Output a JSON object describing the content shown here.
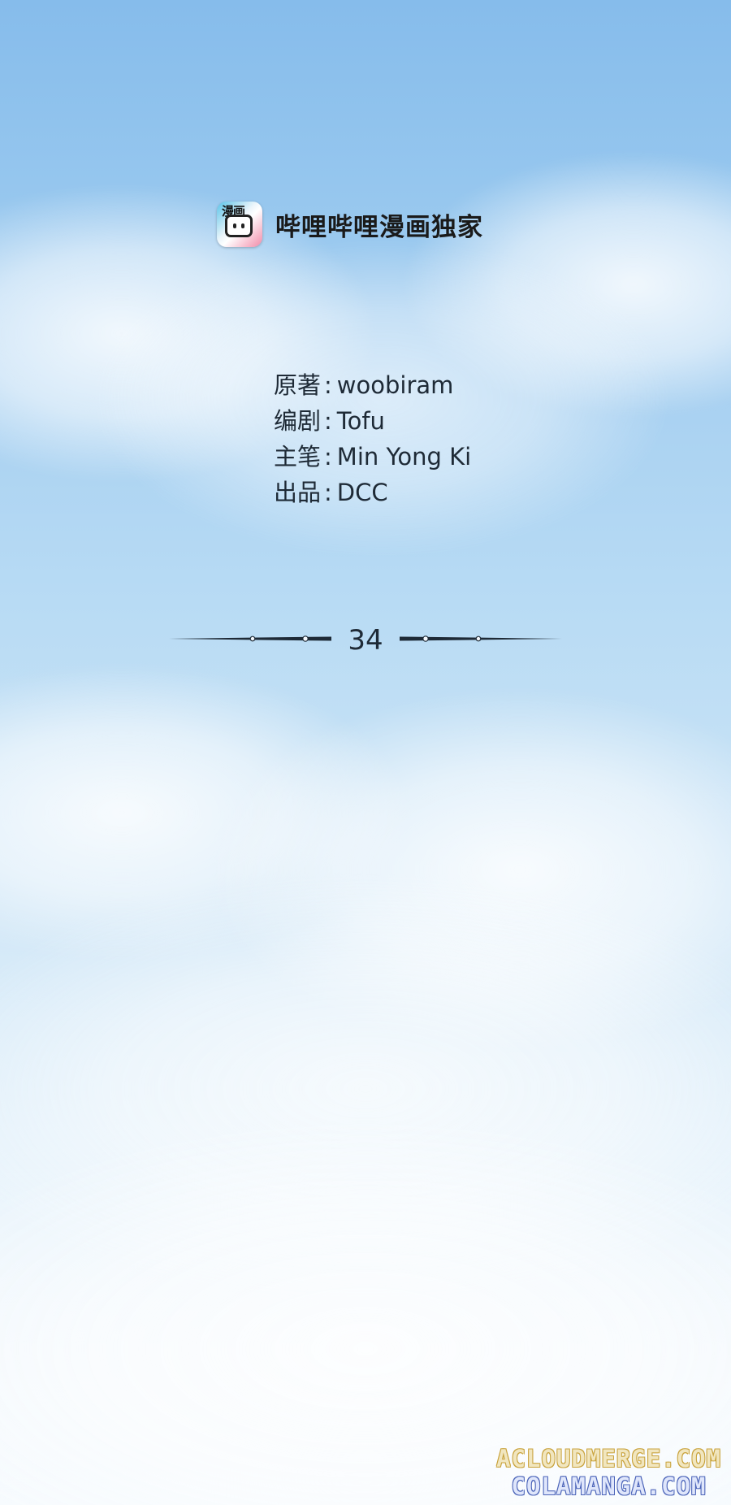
{
  "brand": {
    "logo_text": "漫画",
    "name": "哔哩哔哩漫画独家"
  },
  "credits": [
    {
      "label": "原著",
      "separator": ":",
      "value": "woobiram"
    },
    {
      "label": "编剧",
      "separator": ":",
      "value": "Tofu"
    },
    {
      "label": "主笔",
      "separator": ":",
      "value": "Min Yong Ki"
    },
    {
      "label": "出品",
      "separator": ":",
      "value": "DCC"
    }
  ],
  "chapter": {
    "number": "34"
  },
  "watermark": {
    "line1": "ACLOUDMERGE.COM",
    "line2": "COLAMANGA.COM"
  },
  "colors": {
    "sky_top": "#86bceb",
    "sky_bottom": "#f7fbfe",
    "text": "#1e2a36",
    "watermark_gold": "#c9a33d",
    "watermark_blue": "#4a63b8"
  },
  "icons": {
    "logo": "bilibili-manga-logo-icon",
    "divider": "ornamental-line-icon"
  }
}
